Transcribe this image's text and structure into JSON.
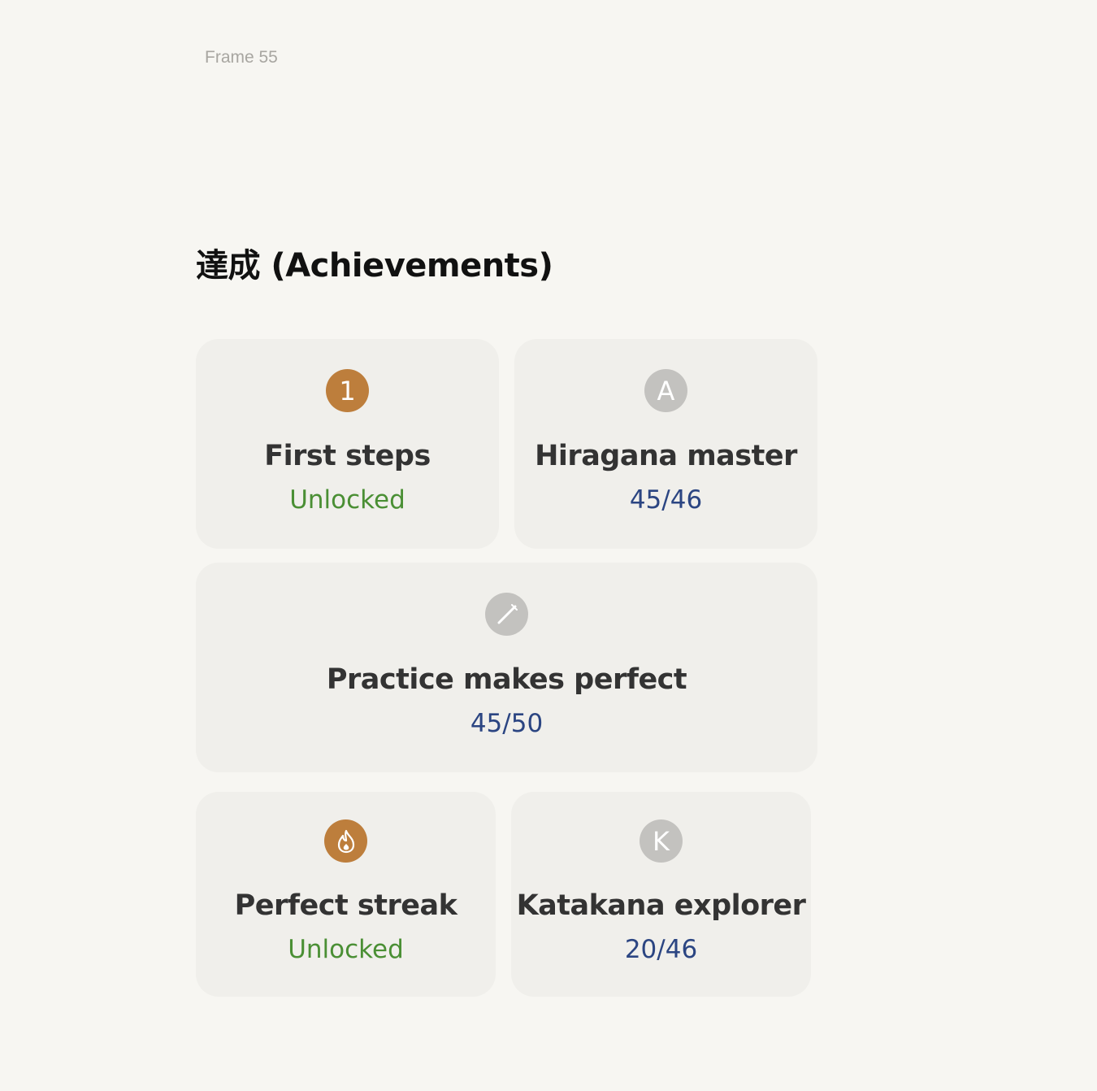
{
  "frame_label": "Frame 55",
  "section": {
    "title": "達成 (Achievements)"
  },
  "colors": {
    "earned_badge": "#bd7e3c",
    "locked_badge": "#c3c2bf",
    "unlocked_text": "#4a8f34",
    "progress_text": "#2b4582",
    "card_background": "#f0efeb",
    "page_background": "#f7f6f2"
  },
  "achievements": [
    {
      "title": "First steps",
      "status": "Unlocked",
      "icon": "number-one-icon",
      "badge_text": "1",
      "unlocked": true
    },
    {
      "title": "Hiragana master",
      "status": "45/46",
      "icon": "letter-a-icon",
      "badge_text": "A",
      "unlocked": false,
      "progress": 0.978
    },
    {
      "title": "Practice makes perfect",
      "status": "45/50",
      "icon": "pencil-icon",
      "unlocked": false,
      "progress": 0.9
    },
    {
      "title": "Perfect streak",
      "status": "Unlocked",
      "icon": "flame-icon",
      "unlocked": true
    },
    {
      "title": "Katakana explorer",
      "status": "20/46",
      "icon": "letter-k-icon",
      "badge_text": "K",
      "unlocked": false,
      "progress": 0.435
    }
  ]
}
